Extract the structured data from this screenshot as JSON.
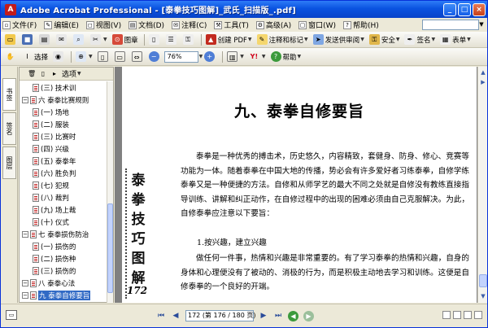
{
  "window": {
    "title": "Adobe Acrobat Professional - [泰拳技巧图解]_武氏_扫描版_.pdf]",
    "app_icon": "acrobat-icon",
    "minimize": "_",
    "maximize": "□",
    "close": "×"
  },
  "menu": {
    "items": [
      {
        "label": "文件(F)",
        "icon": "file-menu-icon"
      },
      {
        "label": "编辑(E)",
        "icon": "edit-menu-icon"
      },
      {
        "label": "视图(V)",
        "icon": "view-menu-icon"
      },
      {
        "label": "文档(D)",
        "icon": "document-menu-icon"
      },
      {
        "label": "注释(C)",
        "icon": "comment-menu-icon"
      },
      {
        "label": "工具(T)",
        "icon": "tools-menu-icon"
      },
      {
        "label": "高级(A)",
        "icon": "advanced-menu-icon"
      },
      {
        "label": "窗口(W)",
        "icon": "window-menu-icon"
      },
      {
        "label": "帮助(H)",
        "icon": "help-menu-icon"
      }
    ]
  },
  "toolbar1": {
    "stamp_label": "图章",
    "create_pdf_label": "创建 PDF",
    "comment_markup_label": "注释和标记",
    "send_review_label": "发送供审阅",
    "secure_label": "安全",
    "sign_label": "签名",
    "forms_label": "表单"
  },
  "toolbar2": {
    "select_label": "选择",
    "zoom_value": "76%",
    "help_label": "帮助"
  },
  "nav_tabs": [
    "书签",
    "签名",
    "图层"
  ],
  "bookmarks": {
    "options_label": "选项",
    "items": [
      {
        "label": "(三) 技术训",
        "level": 2,
        "selected": false
      },
      {
        "label": "六 泰拳比赛规则",
        "level": 1,
        "selected": false
      },
      {
        "label": "(一) 场地",
        "level": 2,
        "selected": false
      },
      {
        "label": "(二) 服装",
        "level": 2,
        "selected": false
      },
      {
        "label": "(三) 比赛时",
        "level": 2,
        "selected": false
      },
      {
        "label": "(四) 兴级",
        "level": 2,
        "selected": false
      },
      {
        "label": "(五) 泰拳年",
        "level": 2,
        "selected": false
      },
      {
        "label": "(六) 胜负判",
        "level": 2,
        "selected": false
      },
      {
        "label": "(七) 犯规",
        "level": 2,
        "selected": false
      },
      {
        "label": "(八) 裁判",
        "level": 2,
        "selected": false
      },
      {
        "label": "(九) 场上裁",
        "level": 2,
        "selected": false
      },
      {
        "label": "(十) 仪式",
        "level": 2,
        "selected": false
      },
      {
        "label": "七 泰拳损伤防治",
        "level": 1,
        "selected": false
      },
      {
        "label": "(一) 损伤的",
        "level": 2,
        "selected": false
      },
      {
        "label": "(二) 损伤种",
        "level": 2,
        "selected": false
      },
      {
        "label": "(三) 损伤的",
        "level": 2,
        "selected": false
      },
      {
        "label": "八 泰拳心法",
        "level": 1,
        "selected": false
      },
      {
        "label": "九 泰拳自修要旨",
        "level": 1,
        "selected": true
      }
    ]
  },
  "document": {
    "heading": "九、泰拳自修要旨",
    "paragraph1": "泰拳是一种优秀的搏击术，历史悠久，内容精致，套健身、防身、修心、竞赛等功能为一体。随着泰拳在中国大地的传播，势必会有许多爱好者习练泰拳，自修学练泰拳又是一种便捷的方法。自修和从师学艺的最大不同之处就是自修没有教练直接指导训练、讲解和纠正动作，在自修过程中的出现的困难必须由自己克服解决。为此，自修泰拳应注意以下要旨：",
    "subheading": "1.按兴趣，建立兴趣",
    "paragraph2": "做任何一件事，热情和兴趣是非常重要的。有了学习泰拳的热情和兴趣，自身的身体和心理便没有了被动的、消极的行为，而是积极主动地去学习和训练。这便是自修泰拳的一个良好的开端。",
    "side_text": "泰拳技巧图解",
    "side_page_number": "172"
  },
  "statusbar": {
    "page_display": "172 (第 176 / 180 页)",
    "first_page": "⏮",
    "prev_page": "◀",
    "next_page": "▶",
    "last_page": "⏭"
  },
  "colors": {
    "titlebar": "#0a53e0",
    "selection": "#316ac5",
    "chrome": "#ece9d8"
  }
}
